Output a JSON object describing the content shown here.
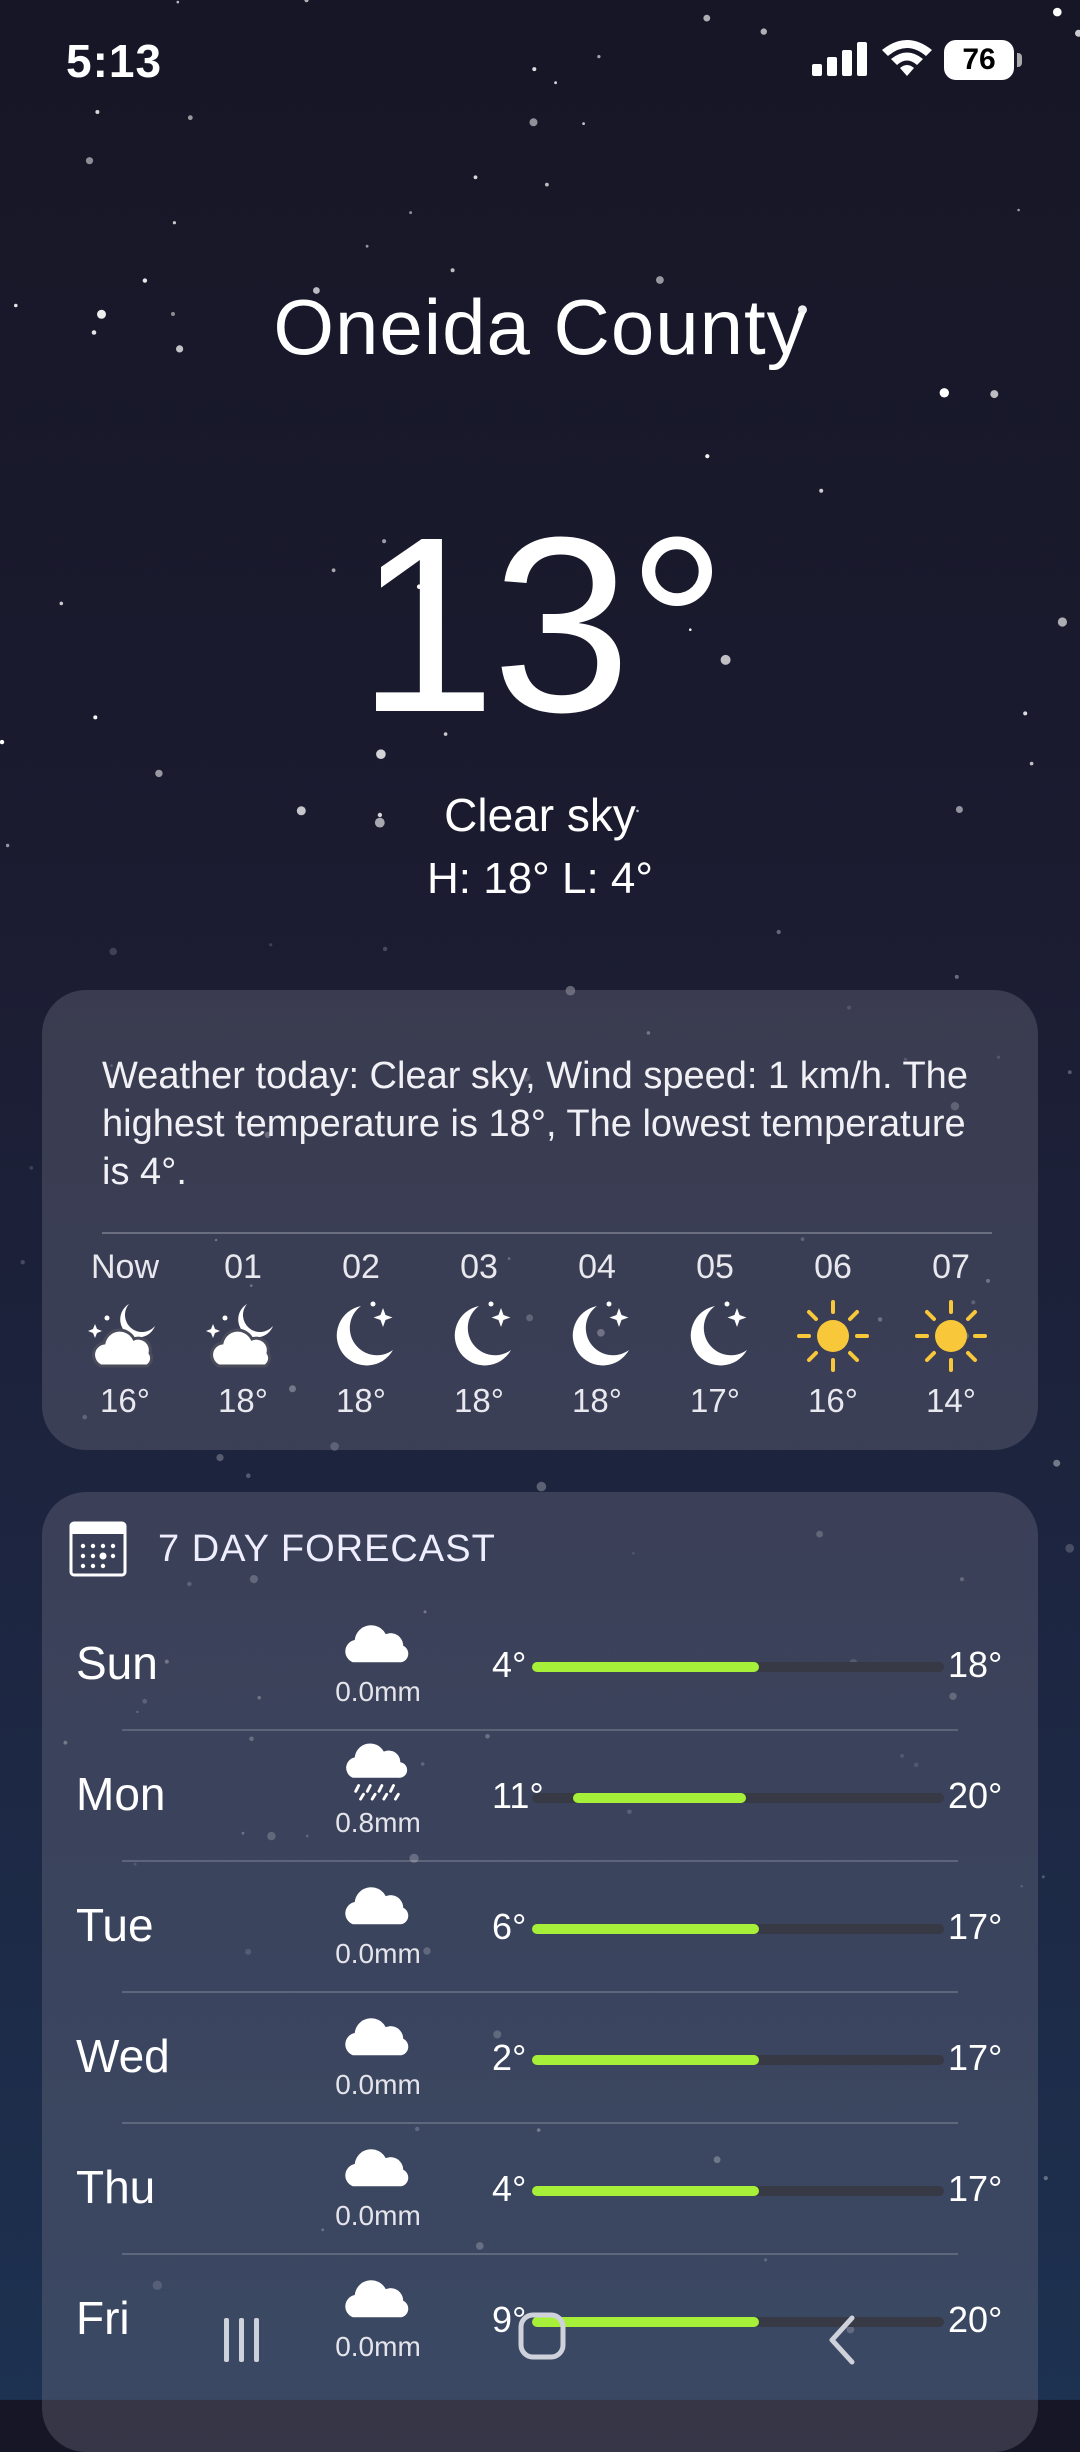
{
  "status_bar": {
    "time": "5:13",
    "battery": "76",
    "icons": [
      "signal-icon",
      "wifi-icon",
      "battery-icon"
    ]
  },
  "location": {
    "name": "Oneida County"
  },
  "current": {
    "temperature": "13°",
    "condition": "Clear sky",
    "high_low": "H: 18° L: 4°"
  },
  "summary": {
    "text": "Weather today: Clear sky, Wind speed: 1 km/h. The highest temperature is 18°, The lowest temperature is 4°."
  },
  "hourly": [
    {
      "label": "Now",
      "icon": "cloud-moon-icon",
      "temp": "16°"
    },
    {
      "label": "01",
      "icon": "cloud-moon-icon",
      "temp": "18°"
    },
    {
      "label": "02",
      "icon": "moon-stars-icon",
      "temp": "18°"
    },
    {
      "label": "03",
      "icon": "moon-stars-icon",
      "temp": "18°"
    },
    {
      "label": "04",
      "icon": "moon-stars-icon",
      "temp": "18°"
    },
    {
      "label": "05",
      "icon": "moon-stars-icon",
      "temp": "17°"
    },
    {
      "label": "06",
      "icon": "sun-icon",
      "temp": "16°"
    },
    {
      "label": "07",
      "icon": "sun-icon",
      "temp": "14°"
    }
  ],
  "forecast": {
    "title": "7 DAY FORECAST",
    "icon": "calendar-icon",
    "days": [
      {
        "day": "Sun",
        "icon": "cloud-icon",
        "precip": "0.0mm",
        "low": "4°",
        "high": "18°",
        "range_start": 0.0,
        "range_end": 0.55
      },
      {
        "day": "Mon",
        "icon": "cloud-rain-icon",
        "precip": "0.8mm",
        "low": "11°",
        "high": "20°",
        "range_start": 0.1,
        "range_end": 0.52
      },
      {
        "day": "Tue",
        "icon": "cloud-icon",
        "precip": "0.0mm",
        "low": "6°",
        "high": "17°",
        "range_start": 0.0,
        "range_end": 0.55
      },
      {
        "day": "Wed",
        "icon": "cloud-icon",
        "precip": "0.0mm",
        "low": "2°",
        "high": "17°",
        "range_start": 0.0,
        "range_end": 0.55
      },
      {
        "day": "Thu",
        "icon": "cloud-icon",
        "precip": "0.0mm",
        "low": "4°",
        "high": "17°",
        "range_start": 0.0,
        "range_end": 0.55
      },
      {
        "day": "Fri",
        "icon": "cloud-icon",
        "precip": "0.0mm",
        "low": "9°",
        "high": "20°",
        "range_start": 0.0,
        "range_end": 0.55
      }
    ]
  },
  "colors": {
    "range_fill": "#a6f03a",
    "sun": "#f9c83a"
  },
  "nav_bar": {
    "buttons": [
      "recents-button",
      "home-button",
      "back-button"
    ]
  }
}
